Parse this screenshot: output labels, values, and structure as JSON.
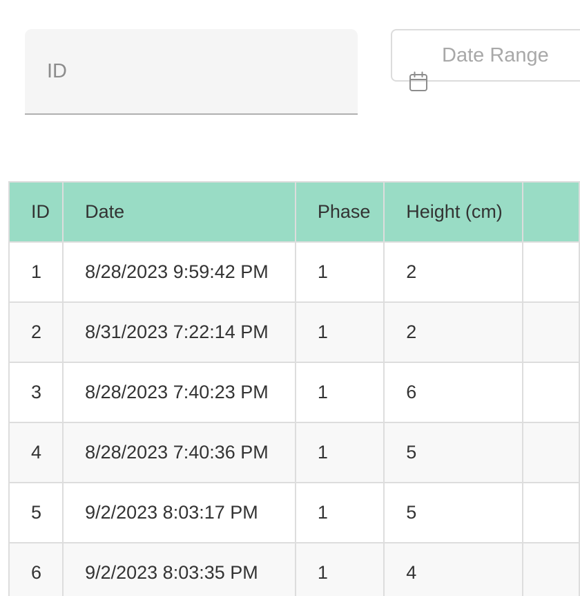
{
  "filters": {
    "id_placeholder": "ID",
    "id_value": "",
    "date_range_placeholder": "Date Range",
    "date_range_value": "",
    "date_icon": "calendar-icon"
  },
  "table": {
    "header_color": "#99dcc5",
    "columns": [
      "ID",
      "Date",
      "Phase",
      "Height (cm)",
      ""
    ],
    "rows": [
      [
        "1",
        "8/28/2023 9:59:42 PM",
        "1",
        "2",
        ""
      ],
      [
        "2",
        "8/31/2023 7:22:14 PM",
        "1",
        "2",
        ""
      ],
      [
        "3",
        "8/28/2023 7:40:23 PM",
        "1",
        "6",
        ""
      ],
      [
        "4",
        "8/28/2023 7:40:36 PM",
        "1",
        "5",
        ""
      ],
      [
        "5",
        "9/2/2023 8:03:17 PM",
        "1",
        "5",
        ""
      ],
      [
        "6",
        "9/2/2023 8:03:35 PM",
        "1",
        "4",
        ""
      ]
    ]
  }
}
